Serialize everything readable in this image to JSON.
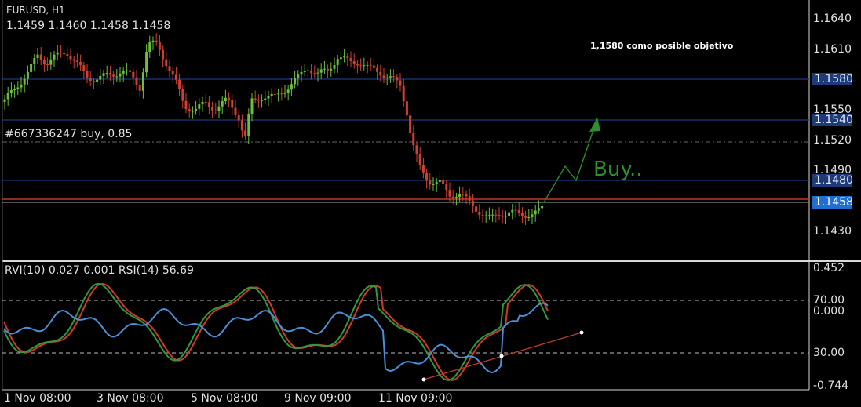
{
  "header": {
    "symbol": "EURUSD, H1",
    "ohlc": "1.1459 1.1460 1.1458 1.1458"
  },
  "order_label": "#667336247 buy, 0.85",
  "annotation_note": "1,1580 como posible objetivo",
  "buy_label": "Buy..",
  "price_axis": {
    "ticks": [
      "1.1640",
      "1.1610",
      "1.1550",
      "1.1520",
      "1.1490",
      "1.1430"
    ],
    "levels": [
      {
        "label": "1.1580",
        "color": "#1e3a78"
      },
      {
        "label": "1.1540",
        "color": "#1e3a78"
      },
      {
        "label": "1.1480",
        "color": "#1e3a78"
      },
      {
        "label": "1.1458",
        "color": "#1f6fd0"
      }
    ]
  },
  "indicator": {
    "label": "RVI(10) 0.027 0.001 RSI(14) 56.69",
    "ticks": [
      "0.452",
      "70.00",
      "0.000",
      "30.00",
      "-0.744"
    ]
  },
  "time_axis": [
    "1 Nov 08:00",
    "3 Nov 08:00",
    "5 Nov 08:00",
    "9 Nov 09:00",
    "11 Nov 09:00"
  ],
  "colors": {
    "bull": "#6abf3c",
    "bear": "#d04030",
    "rvi_main": "#2e9a3a",
    "rvi_signal": "#d03a2a",
    "rsi": "#4a8fd8",
    "level_line": "#1e3a78",
    "bid_line": "#ffffff",
    "ask_line": "#c0392b"
  }
}
